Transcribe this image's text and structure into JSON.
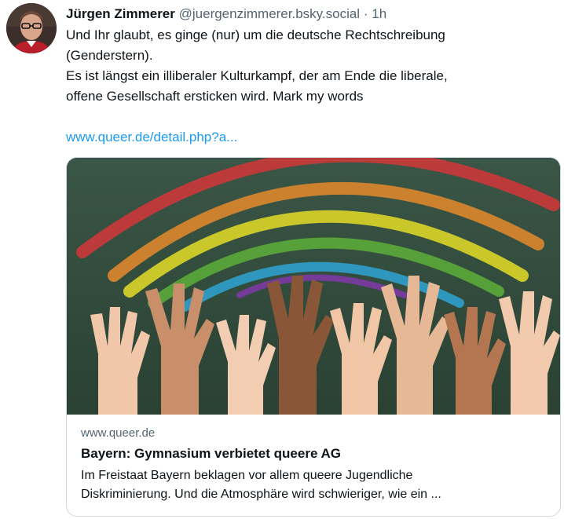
{
  "post": {
    "author_name": "Jürgen Zimmerer",
    "handle": "@juergenzimmerer.bsky.social",
    "separator": "·",
    "time": "1h",
    "text_lines": [
      "Und Ihr glaubt, es ginge (nur) um die deutsche Rechtschreibung",
      "(Genderstern).",
      "Es ist längst ein illiberaler Kulturkampf, der am Ende die liberale,",
      "offene Gesellschaft ersticken wird. Mark my words"
    ],
    "link_text": "www.queer.de/detail.php?a..."
  },
  "card": {
    "domain": "www.queer.de",
    "title": "Bayern: Gymnasium verbietet queere AG",
    "description_lines": [
      "Im Freistaat Bayern beklagen vor allem queere Jugendliche",
      "Diskriminierung. Und die Atmosphäre wird schwieriger, wie ein ..."
    ],
    "image_alt": "Chalkboard with painted rainbow and raised hands"
  },
  "colors": {
    "link": "#1d9bf0",
    "secondary_text": "#536471",
    "border": "#cfd9de",
    "chalkboard": "#2f4a3a"
  }
}
